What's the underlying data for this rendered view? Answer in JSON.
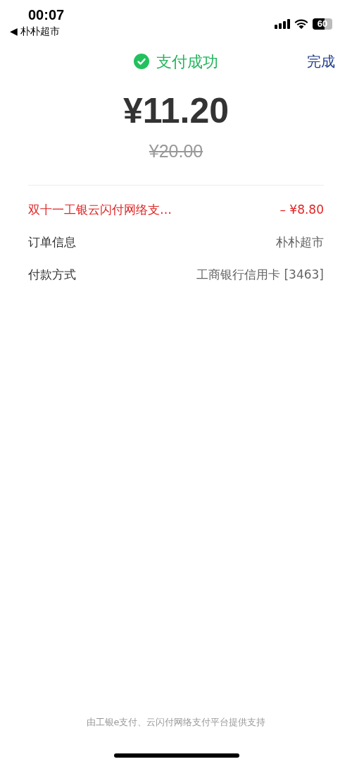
{
  "status_bar": {
    "time": "00:07",
    "back_app": "◀ 朴朴超市",
    "battery": "60"
  },
  "header": {
    "title": "支付成功",
    "done": "完成"
  },
  "amount": "¥11.20",
  "original_amount": "¥20.00",
  "rows": [
    {
      "kind": "discount",
      "label": "双十一工银云闪付网络支…",
      "value": "– ¥8.80"
    },
    {
      "kind": "info",
      "label": "订单信息",
      "value": "朴朴超市"
    },
    {
      "kind": "info",
      "label": "付款方式",
      "value": "工商银行信用卡 [3463]"
    }
  ],
  "footer": "由工银e支付、云闪付网络支付平台提供支持"
}
